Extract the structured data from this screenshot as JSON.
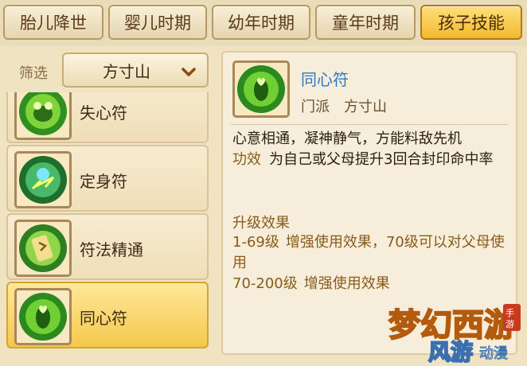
{
  "tabs": [
    {
      "label": "胎儿降世",
      "active": false
    },
    {
      "label": "婴儿时期",
      "active": false
    },
    {
      "label": "幼年时期",
      "active": false
    },
    {
      "label": "童年时期",
      "active": false
    },
    {
      "label": "孩子技能",
      "active": true
    }
  ],
  "filter": {
    "label": "筛选",
    "value": "方寸山",
    "icon": "chevron-down-icon"
  },
  "skills": [
    {
      "name": "失心符",
      "icon": "frog-talisman-icon",
      "selected": false
    },
    {
      "name": "定身符",
      "icon": "lightning-talisman-icon",
      "selected": false
    },
    {
      "name": "符法精通",
      "icon": "scroll-talisman-icon",
      "selected": false
    },
    {
      "name": "同心符",
      "icon": "heart-talisman-icon",
      "selected": true
    }
  ],
  "detail": {
    "name": "同心符",
    "school_label": "门派",
    "school": "方寸山",
    "description": "心意相通，凝神静气，方能料敌先机",
    "effect_label": "功效",
    "effect": "为自己或父母提升3回合封印命中率",
    "upgrade_title": "升级效果",
    "upgrades": [
      {
        "level": "1-69级",
        "text": "增强使用效果，70级可以对父母使用"
      },
      {
        "level": "70-200级",
        "text": "增强使用效果"
      }
    ]
  },
  "watermark": {
    "text": "梦幻西游",
    "sub": "风游",
    "tag": "手游",
    "site": "动漫"
  },
  "colors": {
    "active_tab": "#f2b930",
    "skill_name": "#2a79c8",
    "effect": "#8a5a1a"
  }
}
